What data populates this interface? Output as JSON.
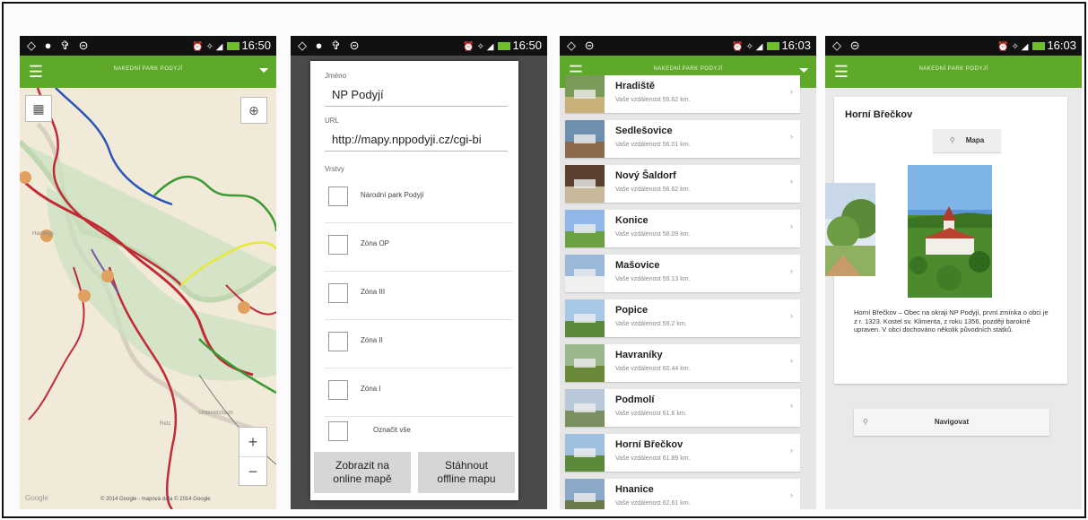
{
  "app": {
    "title": "NAKEDNÍ PARK PODYJÍ"
  },
  "phones": [
    {
      "status_left": "◇ ● ✞ ⊝",
      "status_signal": "⏰ ✧ ◢",
      "status_battery": "77%",
      "time": "16:50"
    },
    {
      "status_left": "◇ ● ✞ ⊝",
      "status_signal": "⏰ ✧ ◢",
      "status_battery": "77%",
      "time": "16:50"
    },
    {
      "status_left": "◇ ⊝",
      "status_signal": "⏰ ✧ ◢",
      "status_battery": "74%",
      "time": "16:03"
    },
    {
      "status_left": "◇ ⊝",
      "status_signal": "⏰ ✧ ◢",
      "status_battery": "74%",
      "time": "16:03"
    }
  ],
  "map": {
    "copyright": "© 2014 Google - mapová data © 2014 Google",
    "google": "Google",
    "labels": [
      "Unterretzbach",
      "Hardegg",
      "Retz"
    ],
    "zoom_in": "+",
    "zoom_out": "−"
  },
  "dialog": {
    "name_label": "Jméno",
    "name_value": "NP Podyjí",
    "url_label": "URL",
    "url_value": "http://mapy.nppodyji.cz/cgi-bi",
    "layers_label": "Vrstvy",
    "layers": [
      "Národní park Podyjí",
      "Zóna OP",
      "Zóna III",
      "Zóna II",
      "Zóna I"
    ],
    "select_all": "Označit vše",
    "btn_online_1": "Zobrazit na",
    "btn_online_2": "online mapě",
    "btn_offline_1": "Stáhnout",
    "btn_offline_2": "offline mapu"
  },
  "list": {
    "items": [
      {
        "name": "Hradiště",
        "dist": "Vaše vzdálenost 55.62 km."
      },
      {
        "name": "Sedlešovice",
        "dist": "Vaše vzdálenost 56.01 km."
      },
      {
        "name": "Nový Šaldorf",
        "dist": "Vaše vzdálenost 56.62 km."
      },
      {
        "name": "Konice",
        "dist": "Vaše vzdálenost 58.09 km."
      },
      {
        "name": "Mašovice",
        "dist": "Vaše vzdálenost 59.13 km."
      },
      {
        "name": "Popice",
        "dist": "Vaše vzdálenost 59.2 km."
      },
      {
        "name": "Havraníky",
        "dist": "Vaše vzdálenost 60.44 km."
      },
      {
        "name": "Podmolí",
        "dist": "Vaše vzdálenost 61.6 km."
      },
      {
        "name": "Horní Břečkov",
        "dist": "Vaše vzdálenost 61.89 km."
      },
      {
        "name": "Hnanice",
        "dist": "Vaše vzdálenost 62.61 km."
      }
    ]
  },
  "detail": {
    "title": "Horní Břečkov",
    "map_button": "Mapa",
    "description": "Horní Břečkov – Obec na okraji NP Podyjí, první zmínka o obci je z r. 1323. Kostel sv. Klimenta, z roku 1356, později barokně upraven. V obci dochováno několik původních statků.",
    "navigate_button": "Navigovat"
  },
  "colors": {
    "appbar": "#5ea92a",
    "status": "#111111"
  }
}
